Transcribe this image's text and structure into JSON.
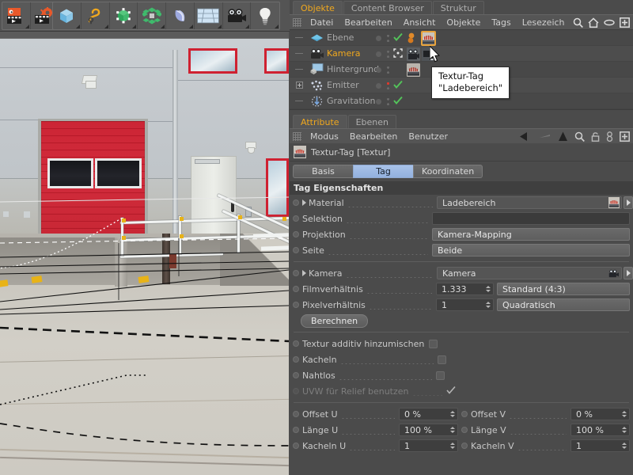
{
  "toolbar": {
    "groups": [
      {
        "name": "render-group",
        "buttons": [
          {
            "name": "render-view-button",
            "icon": "render-view-icon"
          },
          {
            "name": "render-settings-button",
            "icon": "render-settings-icon"
          }
        ]
      },
      {
        "name": "primitives-group",
        "buttons": [
          {
            "name": "cube-button",
            "icon": "cube-icon"
          },
          {
            "name": "spline-button",
            "icon": "spline-icon"
          },
          {
            "name": "nurbs-button",
            "icon": "nurbs-icon"
          },
          {
            "name": "array-button",
            "icon": "array-icon"
          },
          {
            "name": "deformer-button",
            "icon": "bend-deformer-icon"
          },
          {
            "name": "floor-button",
            "icon": "floor-icon"
          },
          {
            "name": "camera-button",
            "icon": "camera-icon"
          },
          {
            "name": "light-button",
            "icon": "light-icon"
          }
        ]
      }
    ]
  },
  "viewport": {
    "hud": [
      "move-hud-icon",
      "scale-hud-icon",
      "rotate-hud-icon",
      "maximize-hud-icon"
    ]
  },
  "object_manager": {
    "tabs": [
      {
        "label": "Objekte",
        "active": true
      },
      {
        "label": "Content Browser",
        "active": false
      },
      {
        "label": "Struktur",
        "active": false
      }
    ],
    "menus": [
      "Datei",
      "Bearbeiten",
      "Ansicht",
      "Objekte",
      "Tags",
      "Lesezeich"
    ],
    "icons": [
      "search-icon",
      "home-icon",
      "eye-icon",
      "plus-box-icon"
    ],
    "rows": [
      {
        "name": "Ebene",
        "icon": "plane-object-icon",
        "selected": false,
        "expandable": false,
        "visdot": "grey",
        "check": "green",
        "tags": [
          "material-orange-icon",
          "texture-tag-icon"
        ]
      },
      {
        "name": "Kamera",
        "icon": "camera-object-icon",
        "selected": true,
        "expandable": false,
        "visdot": "grey",
        "check": "target",
        "tags": [
          "camera-tag-icon",
          "camera-sub-icon"
        ]
      },
      {
        "name": "Hintergrund",
        "icon": "background-object-icon",
        "selected": false,
        "expandable": false,
        "visdot": "grey",
        "check": "none",
        "tags": [
          "texture-tag-icon"
        ]
      },
      {
        "name": "Emitter",
        "icon": "emitter-object-icon",
        "selected": false,
        "expandable": true,
        "visdot": "red",
        "check": "green",
        "tags": []
      },
      {
        "name": "Gravitation",
        "icon": "gravity-object-icon",
        "selected": false,
        "expandable": false,
        "visdot": "grey",
        "check": "green",
        "tags": []
      }
    ]
  },
  "tooltip": {
    "line1": "Textur-Tag",
    "line2": "\"Ladebereich\""
  },
  "attribute_manager": {
    "tabs": [
      {
        "label": "Attribute",
        "active": true
      },
      {
        "label": "Ebenen",
        "active": false
      }
    ],
    "menus": [
      "Modus",
      "Bearbeiten",
      "Benutzer"
    ],
    "icons": [
      "back-arrow-icon",
      "forward-arrow-icon",
      "up-arrow-icon",
      "search-icon",
      "lock-icon",
      "link-icon",
      "plus-box-icon"
    ],
    "object_title": "Textur-Tag [Textur]",
    "object_icon": "texture-tag-icon",
    "page_tabs": [
      {
        "label": "Basis",
        "active": false
      },
      {
        "label": "Tag",
        "active": true
      },
      {
        "label": "Koordinaten",
        "active": false
      }
    ],
    "group_header": "Tag Eigenschaften",
    "properties": [
      {
        "label": "Material",
        "type": "link",
        "value": "Ladebereich",
        "expandable": true,
        "thumb": "texture-tag-icon"
      },
      {
        "label": "Selektion",
        "type": "text",
        "value": ""
      },
      {
        "label": "Projektion",
        "type": "combo",
        "value": "Kamera-Mapping"
      },
      {
        "label": "Seite",
        "type": "combo",
        "value": "Beide"
      }
    ],
    "camera_props": [
      {
        "label": "Kamera",
        "type": "link",
        "value": "Kamera",
        "expandable": true,
        "thumb": "camera-object-icon"
      },
      {
        "label": "Filmverhältnis",
        "type": "numcombo",
        "value": "1.333",
        "combo": "Standard (4:3)"
      },
      {
        "label": "Pixelverhältnis",
        "type": "numcombo",
        "value": "1",
        "combo": "Quadratisch"
      }
    ],
    "compute_button": "Berechnen",
    "checkbox_props": [
      {
        "label": "Textur additiv hinzumischen",
        "checked": false,
        "dimmed": false
      },
      {
        "label": "Kacheln",
        "checked": false,
        "dimmed": false
      },
      {
        "label": "Nahtlos",
        "checked": false,
        "dimmed": false
      },
      {
        "label": "UVW für Relief benutzen",
        "checked": true,
        "dimmed": true
      }
    ],
    "uv_props": [
      {
        "label": "Offset U",
        "value": "0 %",
        "label2": "Offset V",
        "value2": "0 %"
      },
      {
        "label": "Länge U",
        "value": "100 %",
        "label2": "Länge V",
        "value2": "100 %"
      },
      {
        "label": "Kacheln U",
        "value": "1",
        "label2": "Kacheln V",
        "value2": "1"
      }
    ]
  },
  "colors": {
    "accent_orange": "#f0a81e",
    "active_tab_blue": "#93b1df",
    "panel_bg": "#4b4b4b",
    "toolbar_bg": "#545454",
    "gate_red": "#cf2131",
    "check_green": "#53c45a",
    "warn_red": "#e0392c"
  }
}
